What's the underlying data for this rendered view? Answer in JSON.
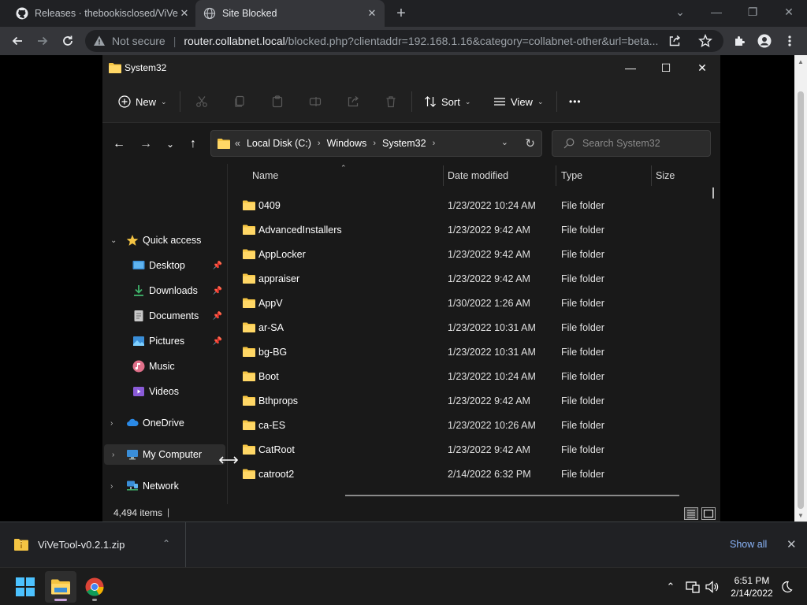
{
  "browser": {
    "tabs": [
      {
        "label": "Releases · thebookisclosed/ViVe",
        "active": false,
        "icon": "github-icon"
      },
      {
        "label": "Site Blocked",
        "active": true,
        "icon": "globe-icon"
      }
    ],
    "omnibox": {
      "security_label": "Not secure",
      "host": "router.collabnet.local",
      "path": "/blocked.php?clientaddr=192.168.1.16&category=collabnet-other&url=beta..."
    }
  },
  "explorer": {
    "title": "System32",
    "commands": {
      "new_label": "New",
      "sort_label": "Sort",
      "view_label": "View",
      "more_label": "•••"
    },
    "breadcrumb": {
      "overflow": "«",
      "items": [
        "Local Disk (C:)",
        "Windows",
        "System32"
      ]
    },
    "search_placeholder": "Search System32",
    "nav": {
      "quick_access": "Quick access",
      "items": [
        {
          "label": "Desktop",
          "pinned": true,
          "icon": "desktop-icon"
        },
        {
          "label": "Downloads",
          "pinned": true,
          "icon": "downloads-icon"
        },
        {
          "label": "Documents",
          "pinned": true,
          "icon": "documents-icon"
        },
        {
          "label": "Pictures",
          "pinned": true,
          "icon": "pictures-icon"
        },
        {
          "label": "Music",
          "pinned": false,
          "icon": "music-icon"
        },
        {
          "label": "Videos",
          "pinned": false,
          "icon": "videos-icon"
        }
      ],
      "onedrive": "OneDrive",
      "my_computer": "My Computer",
      "network": "Network"
    },
    "columns": {
      "name": "Name",
      "date": "Date modified",
      "type": "Type",
      "size": "Size"
    },
    "rows": [
      {
        "name": "0409",
        "date": "1/23/2022 10:24 AM",
        "type": "File folder"
      },
      {
        "name": "AdvancedInstallers",
        "date": "1/23/2022 9:42 AM",
        "type": "File folder"
      },
      {
        "name": "AppLocker",
        "date": "1/23/2022 9:42 AM",
        "type": "File folder"
      },
      {
        "name": "appraiser",
        "date": "1/23/2022 9:42 AM",
        "type": "File folder"
      },
      {
        "name": "AppV",
        "date": "1/30/2022 1:26 AM",
        "type": "File folder"
      },
      {
        "name": "ar-SA",
        "date": "1/23/2022 10:31 AM",
        "type": "File folder"
      },
      {
        "name": "bg-BG",
        "date": "1/23/2022 10:31 AM",
        "type": "File folder"
      },
      {
        "name": "Boot",
        "date": "1/23/2022 10:24 AM",
        "type": "File folder"
      },
      {
        "name": "Bthprops",
        "date": "1/23/2022 9:42 AM",
        "type": "File folder"
      },
      {
        "name": "ca-ES",
        "date": "1/23/2022 10:26 AM",
        "type": "File folder"
      },
      {
        "name": "CatRoot",
        "date": "1/23/2022 9:42 AM",
        "type": "File folder"
      },
      {
        "name": "catroot2",
        "date": "2/14/2022 6:32 PM",
        "type": "File folder"
      }
    ],
    "status": {
      "item_count": "4,494 items"
    }
  },
  "download_bar": {
    "file": "ViVeTool-v0.2.1.zip",
    "show_all": "Show all"
  },
  "taskbar": {
    "time": "6:51 PM",
    "date": "2/14/2022"
  },
  "colors": {
    "folder_yellow": "#f4c443",
    "explorer_bg": "#191919",
    "chrome_dark": "#202124",
    "link_blue": "#8ab4f8"
  }
}
